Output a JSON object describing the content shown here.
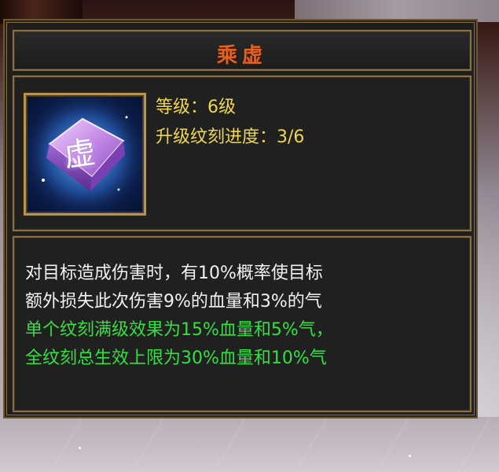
{
  "tooltip": {
    "title": "乘虚",
    "icon": {
      "name": "rune-stone-icon",
      "glyph": "虚",
      "colors": {
        "glow": "#7fd8ff",
        "stone": "#c489e6"
      }
    },
    "level_line": "等级：6级",
    "progress_line": "升级纹刻进度：3/6",
    "description_lines": [
      "对目标造成伤害时，有10%概率使目标",
      "额外损失此次伤害9%的血量和3%的气"
    ],
    "bonus_lines": [
      "单个纹刻满级效果为15%血量和5%气，",
      "全纹刻总生效上限为30%血量和10%气"
    ]
  },
  "colors": {
    "title": "#e0621e",
    "info_text": "#f0d64a",
    "desc_text": "#f2f2f2",
    "bonus_text": "#32e040",
    "frame": "#8a7047",
    "panel_bg": "#202020"
  }
}
